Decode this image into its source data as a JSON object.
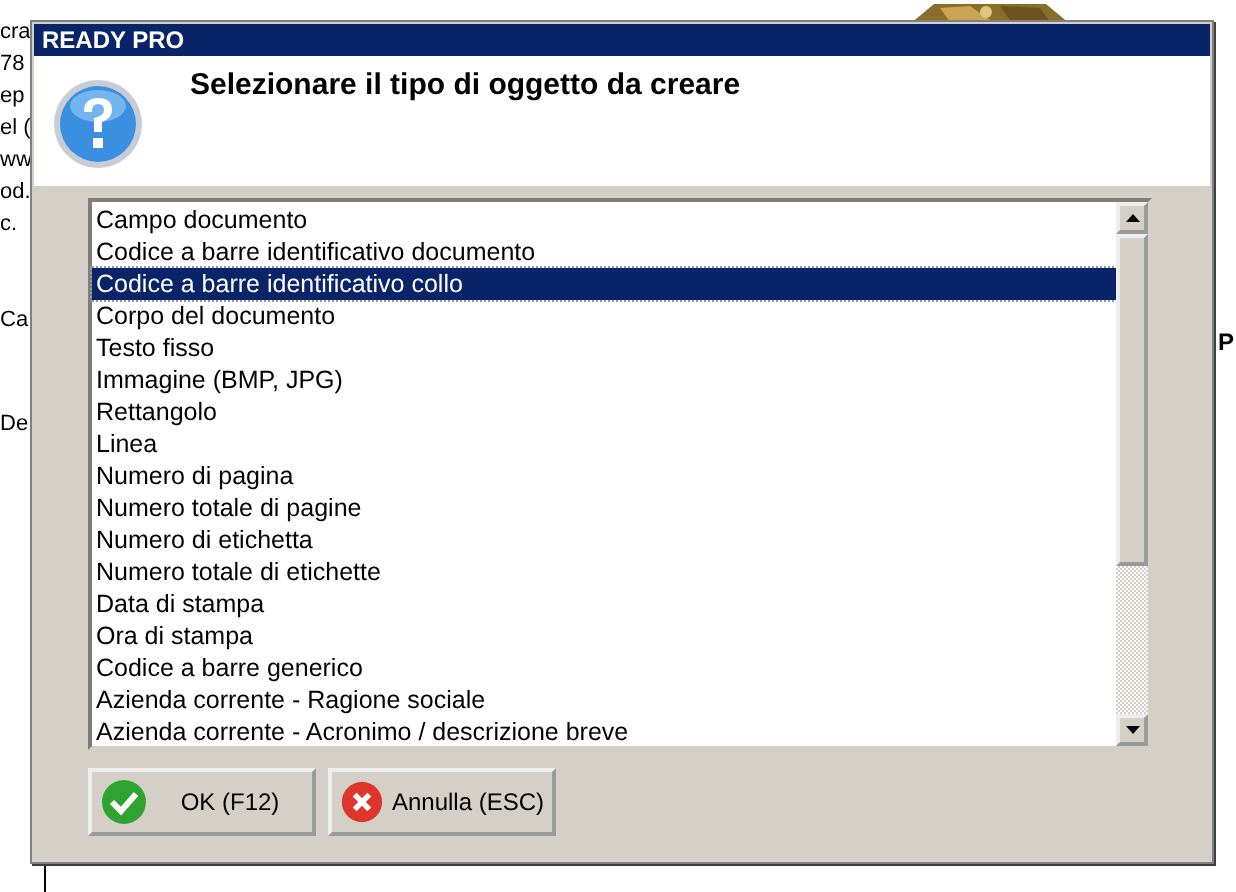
{
  "background": {
    "left_fragments": [
      "cra",
      "78",
      "ep",
      "el (",
      "ww",
      "od.",
      "c.",
      "Ca",
      "De"
    ],
    "right_fragments": [
      "P"
    ],
    "kind": "picture"
  },
  "dialog": {
    "title": "READY PRO",
    "prompt": "Selezionare il tipo di oggetto da creare",
    "items": [
      {
        "label": "Campo documento",
        "selected": false
      },
      {
        "label": "Codice a barre identificativo documento",
        "selected": false
      },
      {
        "label": "Codice a barre identificativo collo",
        "selected": true
      },
      {
        "label": "Corpo del documento",
        "selected": false
      },
      {
        "label": "Testo fisso",
        "selected": false
      },
      {
        "label": "Immagine (BMP, JPG)",
        "selected": false
      },
      {
        "label": "Rettangolo",
        "selected": false
      },
      {
        "label": "Linea",
        "selected": false
      },
      {
        "label": "Numero di pagina",
        "selected": false
      },
      {
        "label": "Numero totale di pagine",
        "selected": false
      },
      {
        "label": "Numero di etichetta",
        "selected": false
      },
      {
        "label": "Numero totale di etichette",
        "selected": false
      },
      {
        "label": "Data di stampa",
        "selected": false
      },
      {
        "label": "Ora di stampa",
        "selected": false
      },
      {
        "label": "Codice a barre generico",
        "selected": false
      },
      {
        "label": "Azienda corrente - Ragione sociale",
        "selected": false
      },
      {
        "label": "Azienda corrente - Acronimo / descrizione breve",
        "selected": false
      }
    ],
    "buttons": [
      {
        "label": "OK (F12)",
        "kind": "ok"
      },
      {
        "label": "Annulla (ESC)",
        "kind": "cancel"
      }
    ]
  }
}
